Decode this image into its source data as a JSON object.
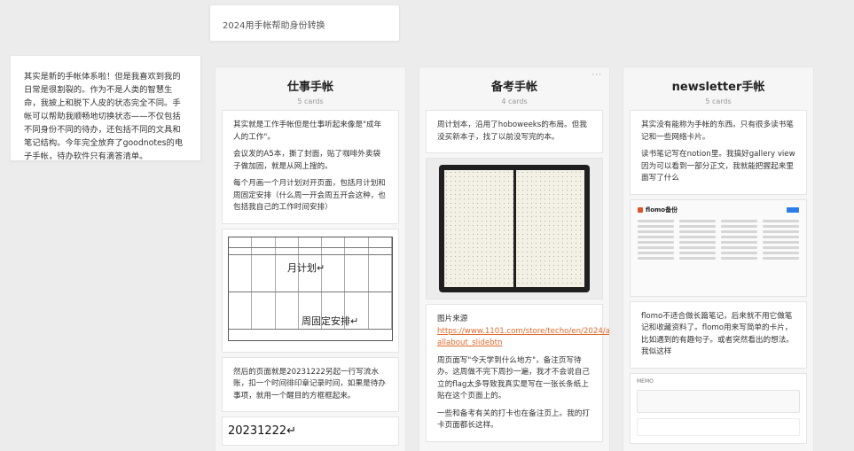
{
  "title_card": {
    "text": "2024用手帐帮助身份转换"
  },
  "intro_card": {
    "text": "其实是新的手帐体系啦！但是我喜欢到我的日常是很割裂的。作为不是人类的智慧生命，我披上和脱下人皮的状态完全不同。手帐可以帮助我顺畅地切换状态——不仅包括不同身份不同的待办，还包括不同的文具和笔记结构。今年完全放弃了goodnotes的电子手帐，待办软件只有滴答清单。"
  },
  "columns": [
    {
      "title": "仕事手帐",
      "count": "5 cards",
      "notes": [
        {
          "paragraphs": [
            "其实就是工作手帐但是仕事听起来像是\"成年人的工作\"。",
            "会议发的A5本，撕了封面，贴了咖啡外卖袋子做加固，就是从网上搜的。",
            "每个月画一个月计划对开页面，包括月计划和周固定安排（什么周一开会周五开会这种，也包括我自己的工作时间安排）"
          ]
        },
        {
          "image": "calendar-plan-image",
          "labels": {
            "month": "月计划↵",
            "week": "周固定安排↵"
          }
        },
        {
          "paragraphs": [
            "然后的页面就是20231222另起一行写流水账，扣一个时间徘印章记录时间，如果是待办事项，就用一个醒目的方框框起来。"
          ]
        },
        {
          "big_text": "20231222↵"
        }
      ]
    },
    {
      "title": "备考手帐",
      "count": "4 cards",
      "more": "···",
      "notes": [
        {
          "paragraphs": [
            "周计划本，沿用了hoboweeks的布局。但我没买新本子，找了以前没写完的本。"
          ]
        },
        {
          "image": "notebook-photo"
        },
        {
          "source_label": "图片来源",
          "link": "https://www.1101.com/store/techo/en/2024/all_about/weeks/?allabout_slidebtn",
          "paragraphs": [
            "周页面写\"今天学到什么地方\"，备注页写待办。这周做不完下周抄一遍，我才不会说自己立的flag太多导致我真实是写在一张长条纸上贴在这个页面上的。",
            "一些和备考有关的打卡也在备注页上。我的打卡页面都长这样。"
          ]
        }
      ]
    },
    {
      "title": "newsletter手帐",
      "count": "5 cards",
      "notes": [
        {
          "paragraphs": [
            "其实没有能称为手帐的东西。只有很多读书笔记和一些网络卡片。",
            "读书笔记写在notion里。我搞好gallery view因为可以看到一部分正文，我就能把握起来里面写了什么"
          ]
        },
        {
          "image": "flomo-screenshot",
          "app_name": "flomo备份"
        },
        {
          "paragraphs": [
            "flomo不适合做长篇笔记，后来就不用它做笔记和收藏资料了。flomo用来写简单的卡片，比如遇到的有趣句子。或者突然看出的想法。我似这样"
          ]
        },
        {
          "image": "memo-screenshot",
          "memo_label": "MEMO"
        }
      ]
    }
  ]
}
